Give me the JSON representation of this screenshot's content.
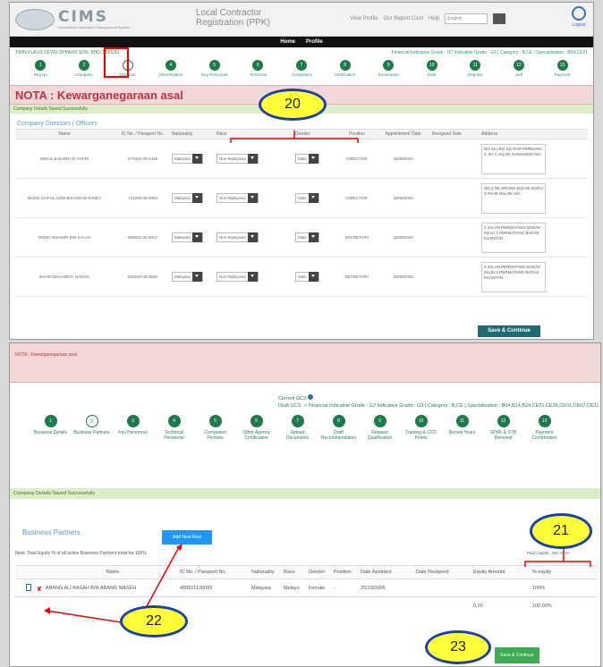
{
  "s1": {
    "logo": "CIMS",
    "logo_sub": "Centralised Information Management System",
    "app_title_1": "Local Contractor",
    "app_title_2": "Registration (PPK)",
    "toplinks": [
      "View Profile",
      "Our Report Card",
      "Help"
    ],
    "lang": "English",
    "logout": "Logout",
    "nav": [
      "Home",
      "Profile"
    ],
    "company": "TWIN FLAGS DEVELOPMENT SDN. BHD.(555526)",
    "grade": "Financial Indicative Grade : G7  Indicative Grade : G3 | Category : B,CE | Specialisation : B04,CE21",
    "steps": [
      {
        "n": "1",
        "l": "Reg.No"
      },
      {
        "n": "2",
        "l": "Company"
      },
      {
        "n": "3",
        "l": "Directors"
      },
      {
        "n": "4",
        "l": "Shareholders"
      },
      {
        "n": "5",
        "l": "Key Personnel"
      },
      {
        "n": "6",
        "l": "Technical"
      },
      {
        "n": "7",
        "l": "Competent"
      },
      {
        "n": "8",
        "l": "Certification"
      },
      {
        "n": "9",
        "l": "Documents"
      },
      {
        "n": "10",
        "l": "Draft"
      },
      {
        "n": "11",
        "l": "Request"
      },
      {
        "n": "12",
        "l": "Self"
      },
      {
        "n": "13",
        "l": "Payment"
      }
    ],
    "nota": "NOTA : Kewarganegaraan asal",
    "saved": "Company Details Saved Successfully",
    "section": "Company Directors / Officers",
    "headers": [
      "Name",
      "IC No. / Passport No.",
      "Nationality",
      "Race",
      "Gender",
      "Position",
      "Appointment Date",
      "Resigned Date",
      "Address"
    ],
    "rows": [
      {
        "name": "ISMAIL B.BADRI @ SAFRI",
        "ic": "670415-08-5435",
        "nat": "Malaysia",
        "race": "Non-Malaysian",
        "gender": "Male",
        "pos": "DIRECTOR",
        "date": "16/09/2002",
        "addr": "NO.15 LRG.SG.RAP PERDANA 1, 87-A JALAN GANGSING N/A"
      },
      {
        "name": "MOHD SAIFUL AZMI BIN MOHD RAMLY",
        "ic": "731208-08-5083",
        "nat": "Malaysia",
        "race": "Non-Malaysian",
        "gender": "Male",
        "pos": "DIRECTOR",
        "date": "16/09/2002",
        "addr": "NO.2 NILORONG BALOK BARU 3 PAHR BALOK N/A"
      },
      {
        "name": "MOHD NIZAMIR BIN SALAH",
        "ic": "580821-06-5017",
        "nat": "Malaysia",
        "race": "Non-Malaysian",
        "gender": "Male",
        "pos": "SECRETARY",
        "date": "16/09/2002",
        "addr": "2 JALAN PERMATANG BADAK MAJU 2 PERMATANG BADAK KUANTAN"
      },
      {
        "name": "BAHRAMAH BINTI HARUN",
        "ic": "640225-08-5830",
        "nat": "Malaysia",
        "race": "Non-Malaysian",
        "gender": "Male",
        "pos": "SECRETARY",
        "date": "16/09/2002",
        "addr": "2 JALAN PERMATANG BADAK MAJU 2 PERMATANG BADAK KUANTAN"
      }
    ],
    "save": "Save & Continue"
  },
  "s2": {
    "nota": "NOTA : Kewarganegaraan asal",
    "gcs_label": "Current GCS",
    "gcs_line": "Draft GCS -> Financial Indicative Grade : G3  Indicative Grade : G3 | Category : B,CE | Specialisation : B04,B14,B24,CE21,CE36,CE01,CE02,CE31",
    "steps": [
      {
        "n": "1",
        "l": "Business Details"
      },
      {
        "n": "2",
        "l": "Business Partners"
      },
      {
        "n": "3",
        "l": "Key Personnel"
      },
      {
        "n": "4",
        "l": "Technical Personnel"
      },
      {
        "n": "5",
        "l": "Competent Persons"
      },
      {
        "n": "6",
        "l": "Other Agency Certification"
      },
      {
        "n": "7",
        "l": "Upload Documents"
      },
      {
        "n": "8",
        "l": "Draft Recommendation"
      },
      {
        "n": "9",
        "l": "Request Qualification"
      },
      {
        "n": "10",
        "l": "Training & CCD Points"
      },
      {
        "n": "11",
        "l": "Renew Years"
      },
      {
        "n": "12",
        "l": "SPKK & STB Renewal"
      },
      {
        "n": "13",
        "l": "Payment Confirmation"
      }
    ],
    "saved": "Company Details Saved Successfully",
    "title": "Business Partners",
    "add": "Add New Row",
    "note": "Note: Total Equity % of all active Business Partners must be 100%",
    "paid": "Paid Capital : RM 3×,0×",
    "headers": [
      "Name",
      "IC No. / Passport No.",
      "Nationality",
      "Race",
      "Gender",
      "Position",
      "Date Apointed",
      "Date Resigned",
      "Equity Amount",
      "% equity"
    ],
    "row": {
      "name": "ABANG ALI BASAH BIN ABANG MASEH",
      "ic": "480821135095",
      "nat": "Malaysia",
      "race": "Melayu",
      "gender": "Female",
      "pos": "-",
      "appt": "25/10/2006",
      "res": "",
      "amt": "",
      "pct": "100%"
    },
    "total_amt": "0.00",
    "total_pct": "100.00%",
    "save": "Save & Continue"
  },
  "callouts": [
    "20",
    "21",
    "22",
    "23"
  ]
}
